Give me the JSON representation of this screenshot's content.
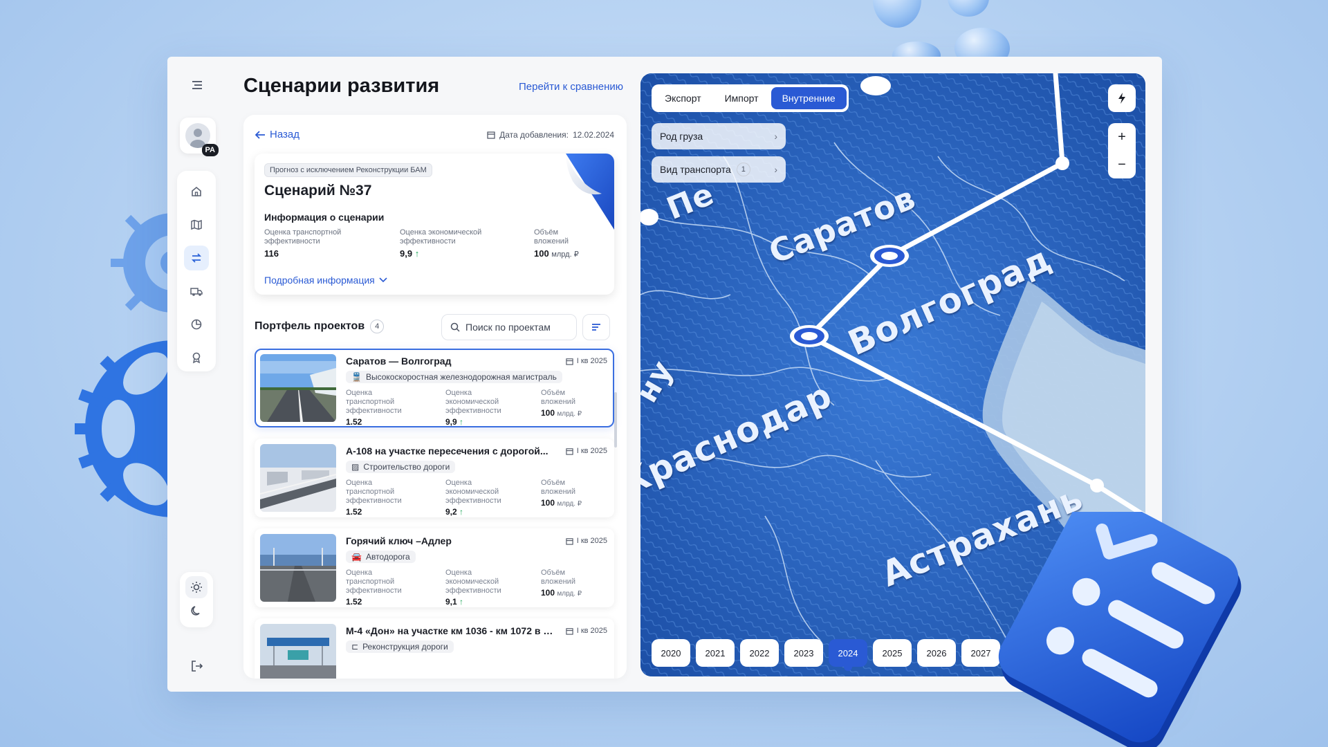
{
  "colors": {
    "accent": "#2a5ad4",
    "positive": "#1fa65a",
    "map_sea": "#1e5bb4"
  },
  "header": {
    "title": "Сценарии развития",
    "compare_link": "Перейти к сравнению"
  },
  "rail": {
    "avatar_badge": "PA",
    "items": [
      {
        "icon": "home-icon"
      },
      {
        "icon": "map-icon"
      },
      {
        "icon": "swap-icon",
        "active": true
      },
      {
        "icon": "truck-icon"
      },
      {
        "icon": "pie-chart-icon"
      },
      {
        "icon": "award-icon"
      }
    ]
  },
  "scenario": {
    "back": "Назад",
    "date_label": "Дата добавления:",
    "date_value": "12.02.2024",
    "chip": "Прогноз с исключением Реконструкции БАМ",
    "title": "Сценарий №37",
    "subtitle": "Информация о сценарии",
    "metrics": [
      {
        "label": "Оценка транспортной эффективности",
        "value": "116"
      },
      {
        "label": "Оценка экономической эффективности",
        "value": "9,9"
      },
      {
        "label": "Объём вложений",
        "value": "100",
        "unit": "млрд. ₽"
      }
    ],
    "more": "Подробная информация"
  },
  "portfolio": {
    "title": "Портфель проектов",
    "count": "4",
    "search_placeholder": "Поиск по проектам",
    "metric_labels": [
      "Оценка транспортной эффективности",
      "Оценка экономической эффективности",
      "Объём вложений"
    ],
    "unit": "млрд. ₽",
    "projects": [
      {
        "title": "Саратов — Волгоград",
        "date": "I кв 2025",
        "type": "Высокоскоростная железнодорожная магистраль",
        "transport": "1.52",
        "economic": "9,9",
        "invest": "100"
      },
      {
        "title": "А-108 на участке пересечения с дорогой...",
        "date": "I кв 2025",
        "type": "Строительство дороги",
        "transport": "1.52",
        "economic": "9,2",
        "invest": "100"
      },
      {
        "title": "Горячий ключ –Адлер",
        "date": "I кв 2025",
        "type": "Автодорога",
        "transport": "1.52",
        "economic": "9,1",
        "invest": "100"
      },
      {
        "title": "М-4 «Дон» на участке км 1036 - км 1072 в Р...",
        "date": "I кв 2025",
        "type": "Реконструкция дороги"
      }
    ]
  },
  "map": {
    "tabs": [
      "Экспорт",
      "Импорт",
      "Внутренние"
    ],
    "active_tab": "Внутренние",
    "filters": [
      {
        "label": "Род груза"
      },
      {
        "label": "Вид транспорта",
        "count": "1"
      }
    ],
    "zoom_in": "+",
    "zoom_out": "−",
    "cities": [
      "Пе",
      "Саратов",
      "Волгоград",
      "Краснодар",
      "Астрахань",
      "ну"
    ],
    "years": [
      "2020",
      "2021",
      "2022",
      "2023",
      "2024",
      "2025",
      "2026",
      "2027"
    ],
    "active_year": "2024"
  }
}
